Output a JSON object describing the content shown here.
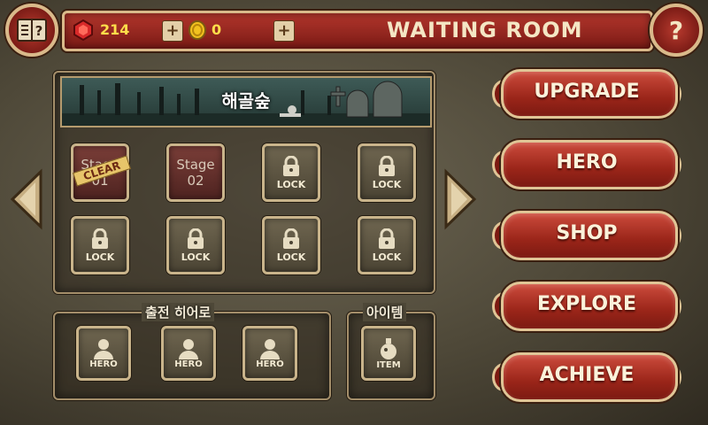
{
  "topbar": {
    "gems": "214",
    "gold": "0",
    "title": "WAITING ROOM",
    "help": "?"
  },
  "stage_panel": {
    "area_name": "해골숲",
    "slots": [
      {
        "type": "stage",
        "word": "Stage",
        "num": "01",
        "badge": "CLEAR"
      },
      {
        "type": "stage",
        "word": "Stage",
        "num": "02"
      },
      {
        "type": "lock",
        "label": "LOCK"
      },
      {
        "type": "lock",
        "label": "LOCK"
      },
      {
        "type": "lock",
        "label": "LOCK"
      },
      {
        "type": "lock",
        "label": "LOCK"
      },
      {
        "type": "lock",
        "label": "LOCK"
      },
      {
        "type": "lock",
        "label": "LOCK"
      }
    ]
  },
  "heroes": {
    "title": "출전 히어로",
    "slots": [
      "HERO",
      "HERO",
      "HERO"
    ]
  },
  "items": {
    "title": "아이템",
    "slot": "ITEM"
  },
  "menu": [
    "UPGRADE",
    "HERO",
    "SHOP",
    "EXPLORE",
    "ACHIEVE"
  ],
  "colors": {
    "accent_red": "#a22a1f",
    "frame_gold": "#d9b98a",
    "gem": "#e23a3a",
    "coin": "#f2c21f"
  }
}
